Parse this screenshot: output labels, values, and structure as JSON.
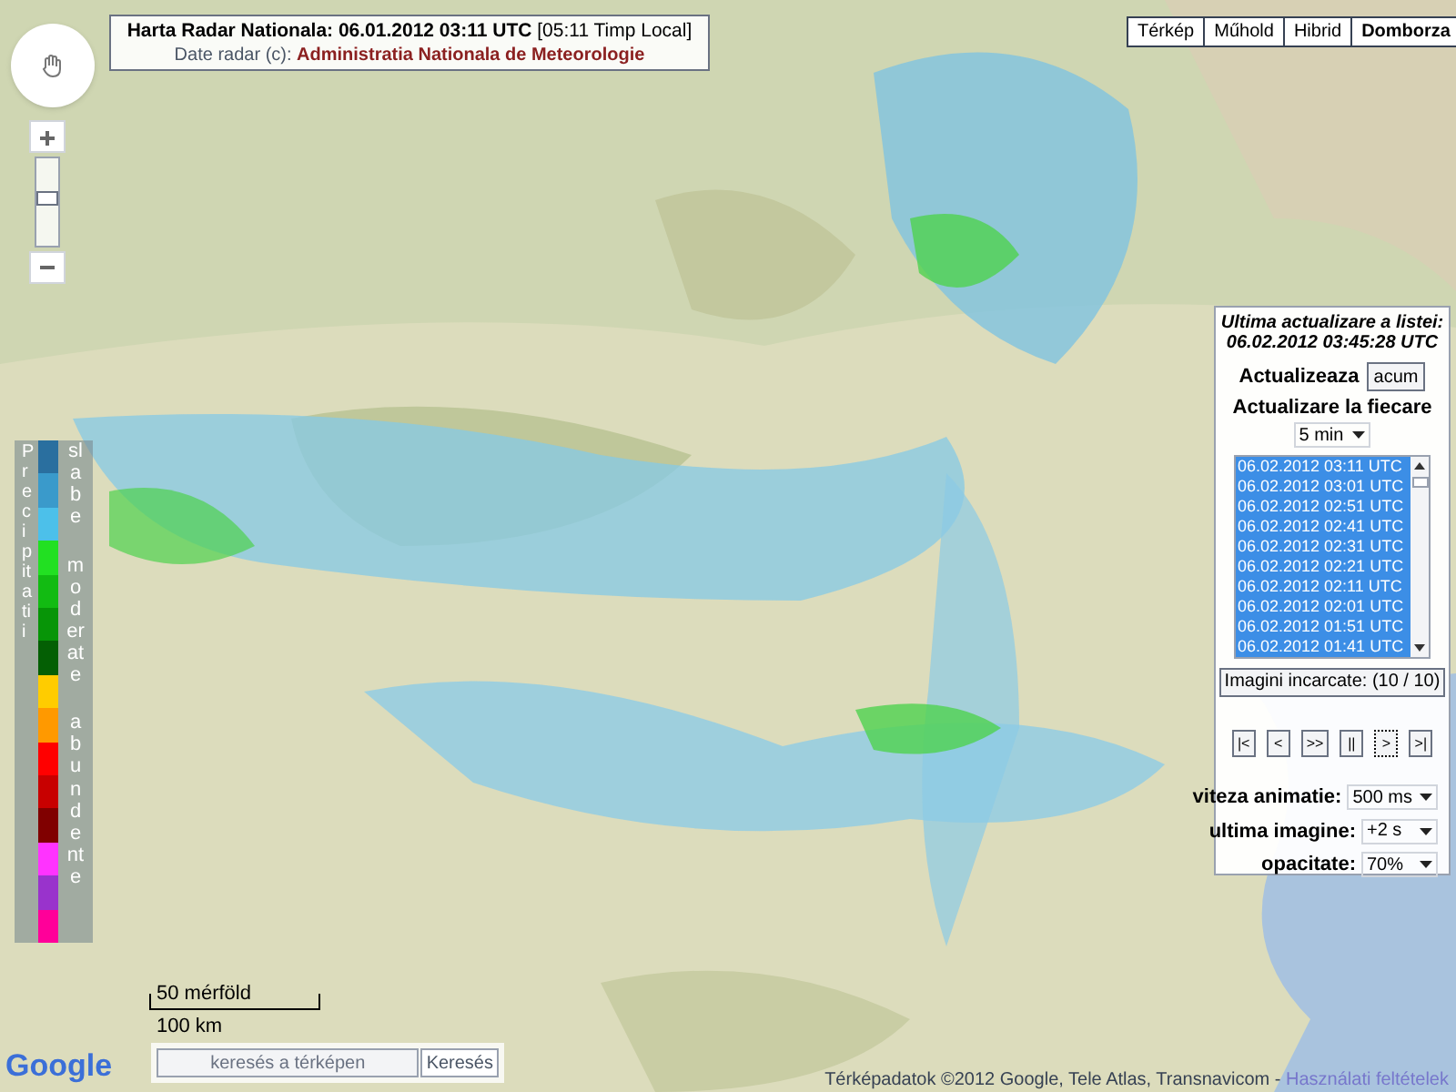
{
  "header": {
    "title": "Harta Radar Nationala: 06.01.2012 03:11 UTC",
    "local_time": "[05:11 Timp Local]",
    "source_label": "Date radar (c):",
    "source": "Administratia Nationala de Meteorologie"
  },
  "map_types": [
    {
      "label": "Térkép",
      "selected": false
    },
    {
      "label": "Műhold",
      "selected": false
    },
    {
      "label": "Hibrid",
      "selected": false
    },
    {
      "label": "Domborza",
      "selected": true
    }
  ],
  "zoom": {
    "level": 0.55
  },
  "legend": {
    "title": "Precipitatii",
    "levels": [
      "slabe",
      "moderate",
      "abundente"
    ],
    "swatches": [
      {
        "color": "#2a6f9f"
      },
      {
        "color": "#3a9acb"
      },
      {
        "color": "#4cc0ea"
      },
      {
        "color": "#22e022"
      },
      {
        "color": "#12bb12"
      },
      {
        "color": "#079507"
      },
      {
        "color": "#045f04"
      },
      {
        "color": "#ffcc00"
      },
      {
        "color": "#ff9900"
      },
      {
        "color": "#ff0000"
      },
      {
        "color": "#c80000"
      },
      {
        "color": "#800000"
      },
      {
        "color": "#ff33ff"
      },
      {
        "color": "#9933cc"
      },
      {
        "color": "#ff0099"
      }
    ]
  },
  "panel": {
    "updated_label": "Ultima actualizare a listei:",
    "updated": "06.02.2012 03:45:28 UTC",
    "refresh_label": "Actualizeaza",
    "refresh_button": "acum",
    "interval_label": "Actualizare la fiecare",
    "interval": "5 min",
    "images": [
      {
        "label": "06.02.2012 03:11 UTC",
        "selected": true
      },
      {
        "label": "06.02.2012 03:01 UTC",
        "selected": true
      },
      {
        "label": "06.02.2012 02:51 UTC",
        "selected": true
      },
      {
        "label": "06.02.2012 02:41 UTC",
        "selected": true
      },
      {
        "label": "06.02.2012 02:31 UTC",
        "selected": true
      },
      {
        "label": "06.02.2012 02:21 UTC",
        "selected": true
      },
      {
        "label": "06.02.2012 02:11 UTC",
        "selected": true
      },
      {
        "label": "06.02.2012 02:01 UTC",
        "selected": true
      },
      {
        "label": "06.02.2012 01:51 UTC",
        "selected": true
      },
      {
        "label": "06.02.2012 01:41 UTC",
        "selected": true
      }
    ],
    "loaded": "Imagini incarcate: (10 / 10)",
    "controls": [
      {
        "label": "|<",
        "focused": false
      },
      {
        "label": "<",
        "focused": false
      },
      {
        "label": ">>",
        "focused": false
      },
      {
        "label": "||",
        "focused": false
      },
      {
        "label": ">",
        "focused": true
      },
      {
        "label": ">|",
        "focused": false
      }
    ],
    "settings": [
      {
        "label": "viteza animatie:",
        "value": "500 ms"
      },
      {
        "label": "ultima imagine:",
        "value": "+2 s"
      },
      {
        "label": "opacitate:",
        "value": "70%"
      }
    ]
  },
  "scale": {
    "imperial": "50 mérföld",
    "metric": "100 km"
  },
  "logo": "Google",
  "search": {
    "placeholder": "keresés a térképen",
    "button": "Keresés"
  },
  "footer": {
    "attribution": "Térképadatok ©2012 Google, Tele Atlas, Transnavicom - ",
    "terms_link": "Használati feltételek"
  }
}
